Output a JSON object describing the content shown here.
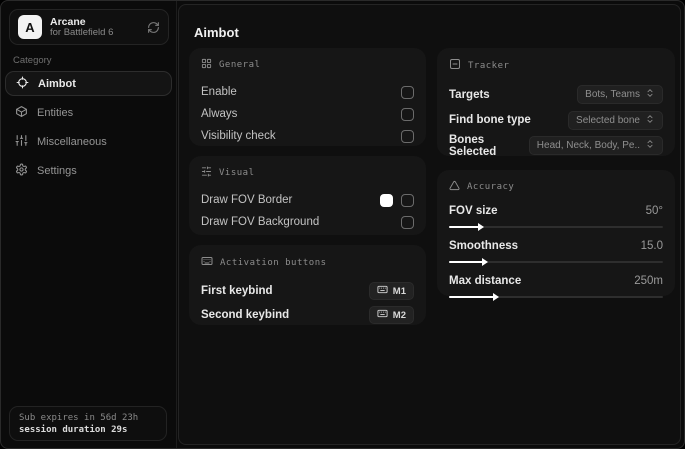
{
  "app": {
    "name": "Arcane",
    "subtitle": "for Battlefield 6",
    "logo_letter": "A"
  },
  "sidebar": {
    "category_label": "Category",
    "items": [
      {
        "label": "Aimbot",
        "icon": "crosshair-icon",
        "active": true
      },
      {
        "label": "Entities",
        "icon": "box-icon",
        "active": false
      },
      {
        "label": "Miscellaneous",
        "icon": "sliders-icon",
        "active": false
      },
      {
        "label": "Settings",
        "icon": "gear-icon",
        "active": false
      }
    ],
    "subscription": {
      "line1": "Sub expires in 56d 23h",
      "line2": "session duration 29s"
    }
  },
  "main": {
    "title": "Aimbot",
    "cards": {
      "general": {
        "title": "General",
        "icon": "grid-icon",
        "rows": [
          {
            "label": "Enable",
            "checked": false
          },
          {
            "label": "Always",
            "checked": false
          },
          {
            "label": "Visibility check",
            "checked": false
          }
        ]
      },
      "visual": {
        "title": "Visual",
        "icon": "sliders-horizontal-icon",
        "rows": [
          {
            "label": "Draw FOV Border",
            "swatch": "#ffffff",
            "checked": false
          },
          {
            "label": "Draw FOV Background",
            "checked": false
          }
        ]
      },
      "activation": {
        "title": "Activation buttons",
        "icon": "keyboard-icon",
        "rows": [
          {
            "label": "First keybind",
            "key": "M1"
          },
          {
            "label": "Second keybind",
            "key": "M2"
          }
        ]
      },
      "tracker": {
        "title": "Tracker",
        "icon": "minus-square-icon",
        "rows": [
          {
            "label": "Targets",
            "value": "Bots, Teams"
          },
          {
            "label": "Find bone type",
            "value": "Selected bone"
          },
          {
            "label": "Bones Selected",
            "value": "Head, Neck, Body, Pe.."
          }
        ]
      },
      "accuracy": {
        "title": "Accuracy",
        "icon": "triangle-icon",
        "rows": [
          {
            "label": "FOV size",
            "value": "50°",
            "percent": 14
          },
          {
            "label": "Smoothness",
            "value": "15.0",
            "percent": 16
          },
          {
            "label": "Max distance",
            "value": "250m",
            "percent": 21
          }
        ]
      }
    }
  },
  "colors": {
    "accent": "#ffffff",
    "card_bg": "#161616",
    "window_bg": "#0b0b0b"
  }
}
